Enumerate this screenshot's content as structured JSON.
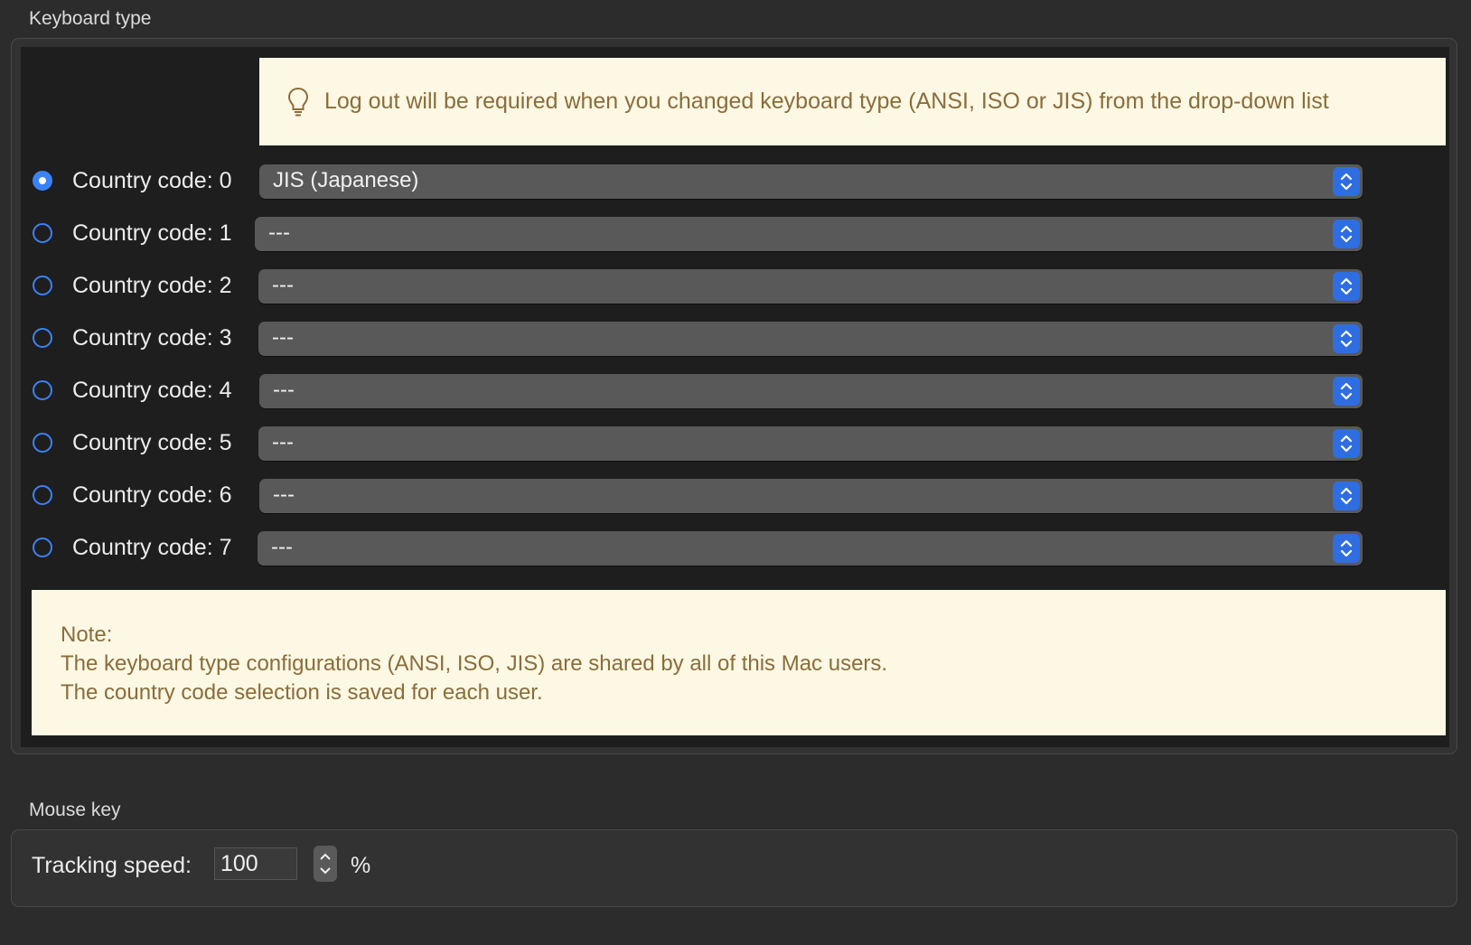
{
  "keyboard_type": {
    "title": "Keyboard type",
    "tip": "Log out will be required when you changed keyboard type (ANSI, ISO or JIS) from the drop-down list",
    "rows": [
      {
        "label": "Country code: 0",
        "value": "JIS (Japanese)",
        "selected": true
      },
      {
        "label": "Country code: 1",
        "value": "---",
        "selected": false
      },
      {
        "label": "Country code: 2",
        "value": "---",
        "selected": false
      },
      {
        "label": "Country code: 3",
        "value": "---",
        "selected": false
      },
      {
        "label": "Country code: 4",
        "value": "---",
        "selected": false
      },
      {
        "label": "Country code: 5",
        "value": "---",
        "selected": false
      },
      {
        "label": "Country code: 6",
        "value": "---",
        "selected": false
      },
      {
        "label": "Country code: 7",
        "value": "---",
        "selected": false
      }
    ],
    "note": {
      "heading": "Note:",
      "line1": "The keyboard type configurations (ANSI, ISO, JIS) are shared by all of this Mac users.",
      "line2": "The country code selection is saved for each user."
    }
  },
  "mouse_key": {
    "title": "Mouse key",
    "tracking_label": "Tracking speed:",
    "tracking_value": "100",
    "unit": "%"
  },
  "colors": {
    "accent": "#2f6ee0",
    "tip_background": "#fcf8e4",
    "tip_text": "#8a6d3b"
  }
}
